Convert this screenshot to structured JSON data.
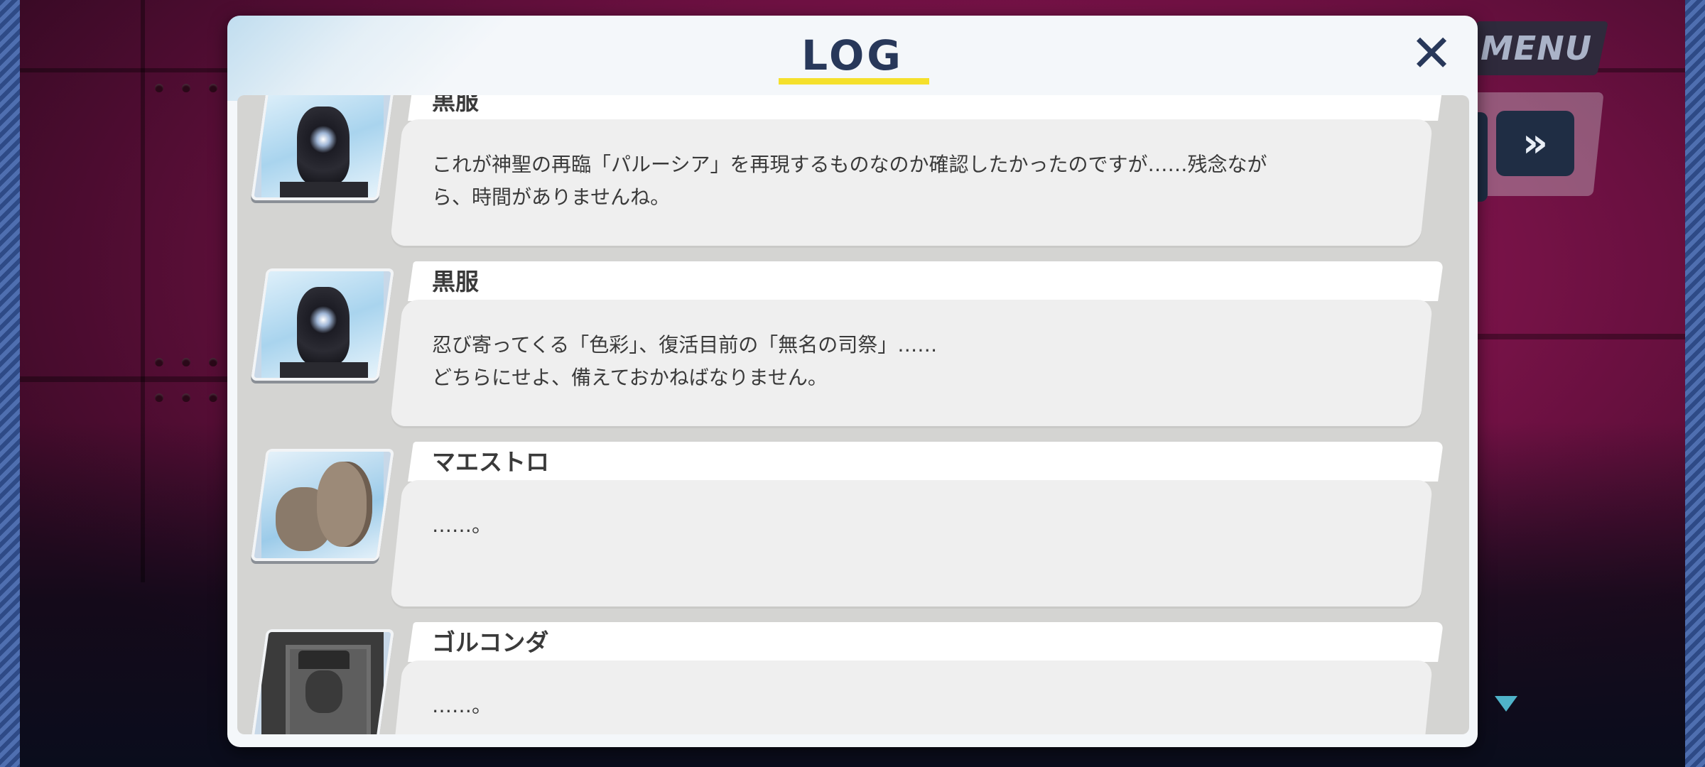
{
  "menu": {
    "label": "MENU"
  },
  "controls": {
    "skip_glyph": "»"
  },
  "log": {
    "title": "LOG",
    "close_glyph": "✕",
    "entries": [
      {
        "speaker": "黒服",
        "portrait": "kurofuku-portrait",
        "lines": [
          "これが神聖の再臨「パルーシア」を再現するものなのか確認したかったのですが……残念なが",
          "ら、時間がありませんね。"
        ]
      },
      {
        "speaker": "黒服",
        "portrait": "kurofuku-portrait",
        "lines": [
          "忍び寄ってくる「色彩」、復活目前の「無名の司祭」……",
          "どちらにせよ、備えておかねばなりません。"
        ]
      },
      {
        "speaker": "マエストロ",
        "portrait": "maestro-portrait",
        "lines": [
          "……。"
        ]
      },
      {
        "speaker": "ゴルコンダ",
        "portrait": "golconda-portrait",
        "lines": [
          "……。"
        ]
      }
    ]
  }
}
